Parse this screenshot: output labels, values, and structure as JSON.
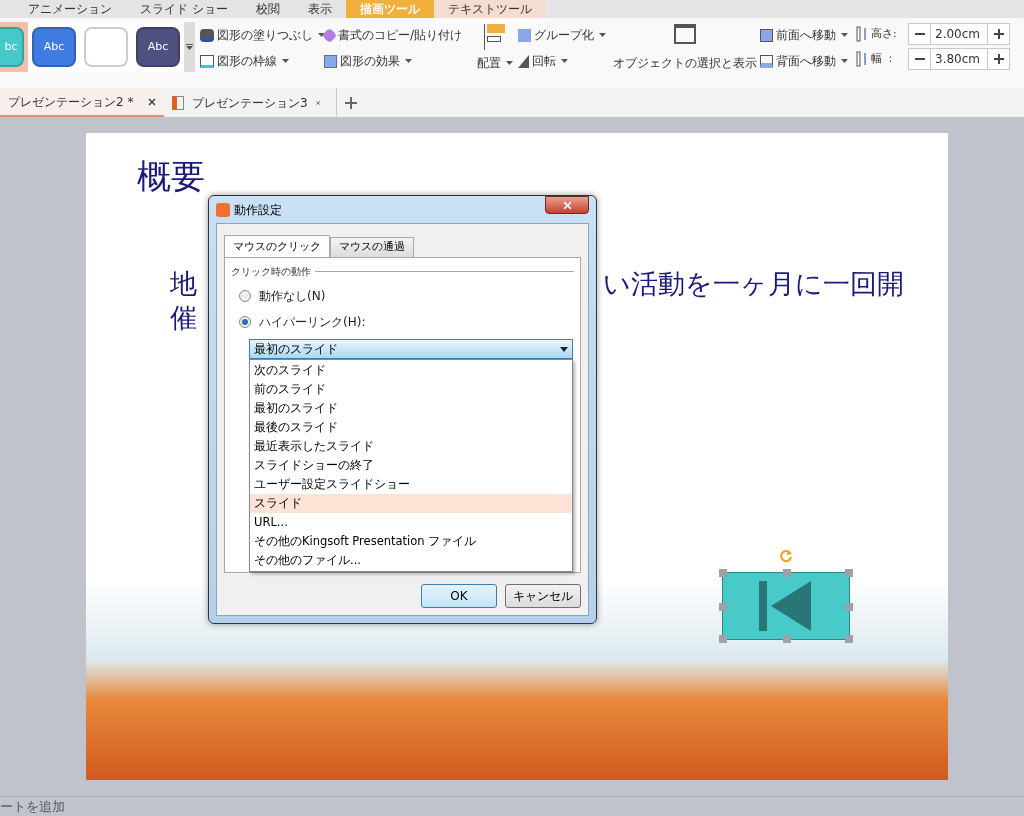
{
  "ribbon_tabs": [
    {
      "label": "アニメーション",
      "selected": false,
      "kind": "normal"
    },
    {
      "label": "スライド ショー",
      "selected": false,
      "kind": "normal"
    },
    {
      "label": "校閲",
      "selected": false,
      "kind": "normal"
    },
    {
      "label": "表示",
      "selected": false,
      "kind": "normal"
    },
    {
      "label": "描画ツール",
      "selected": true,
      "kind": "context"
    },
    {
      "label": "テキストツール",
      "selected": false,
      "kind": "context"
    }
  ],
  "style_gallery": [
    {
      "label": "bc",
      "color": "#45c8c8",
      "selected": true
    },
    {
      "label": "Abc",
      "color": "#3f7be0",
      "selected": false
    },
    {
      "color": "#ffffff",
      "selected": false
    },
    {
      "label": "Abc",
      "color": "#4e5080",
      "selected": false
    }
  ],
  "ribbon": {
    "fill": "図形の塗りつぶし",
    "outline": "図形の枠線",
    "format_painter": "書式のコピー/貼り付け",
    "effects": "図形の効果",
    "align": "配置",
    "group": "グループ化",
    "rotate": "回転",
    "selection_pane": "オブジェクトの選択と表示",
    "bring_forward": "前面へ移動",
    "send_backward": "背面へ移動",
    "height_label": "高さ:",
    "height_value": "2.00cm",
    "width_label": "幅 ：",
    "width_value": "3.80cm"
  },
  "doc_tabs": [
    {
      "label": "プレゼンテーション2 *",
      "selected": true
    },
    {
      "label": "プレゼンテーション3",
      "selected": false
    }
  ],
  "slide": {
    "title": "概要",
    "body_line1_left": "地",
    "body_line1_right": "い活動を一ヶ月に一回開",
    "body_line2_left": "催"
  },
  "dialog": {
    "title": "動作設定",
    "tabs": [
      {
        "label": "マウスのクリック",
        "selected": true
      },
      {
        "label": "マウスの通過",
        "selected": false
      }
    ],
    "group_label": "クリック時の動作",
    "radios": [
      {
        "label": "動作なし(N)",
        "selected": false
      },
      {
        "label": "ハイパーリンク(H):",
        "selected": true
      }
    ],
    "select_value": "最初のスライド",
    "options": [
      {
        "label": "次のスライド",
        "selected": false
      },
      {
        "label": "前のスライド",
        "selected": false
      },
      {
        "label": "最初のスライド",
        "selected": false
      },
      {
        "label": "最後のスライド",
        "selected": false
      },
      {
        "label": "最近表示したスライド",
        "selected": false
      },
      {
        "label": "スライドショーの終了",
        "selected": false
      },
      {
        "label": "ユーザー設定スライドショー",
        "selected": false
      },
      {
        "label": "スライド",
        "selected": true
      },
      {
        "label": "URL...",
        "selected": false
      },
      {
        "label": "その他のKingsoft Presentation ファイル",
        "selected": false
      },
      {
        "label": "その他のファイル...",
        "selected": false
      }
    ],
    "ok": "OK",
    "cancel": "キャンセル"
  },
  "notes": {
    "placeholder": "ートを追加"
  }
}
